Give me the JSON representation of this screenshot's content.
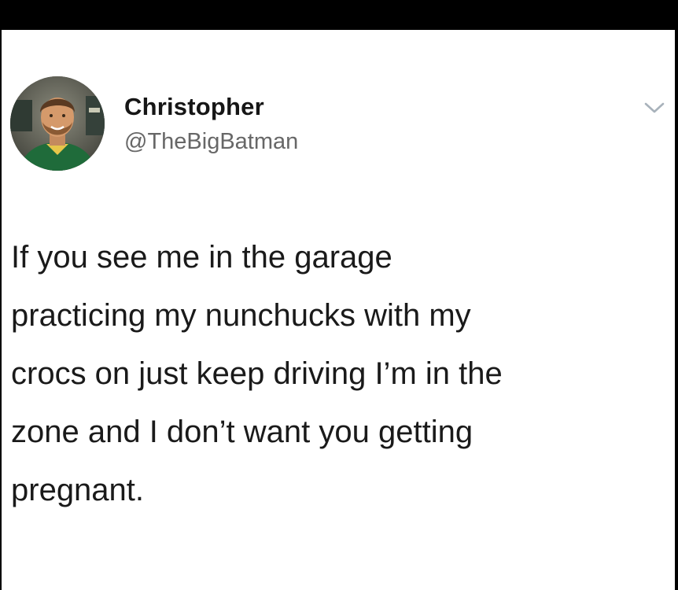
{
  "tweet": {
    "author": {
      "display_name": "Christopher",
      "handle": "@TheBigBatman",
      "avatar_icon": "profile-photo"
    },
    "menu_icon": "chevron-down-icon",
    "text_lines": [
      "If you see me in the garage",
      "practicing my nunchucks with my",
      "crocs on just keep driving I’m in the",
      "zone and I don’t want you getting",
      "pregnant."
    ]
  },
  "colors": {
    "background": "#ffffff",
    "frame": "#000000",
    "name": "#161616",
    "handle": "#676767",
    "text": "#1a1a1a",
    "chevron": "#a8b2bb"
  }
}
